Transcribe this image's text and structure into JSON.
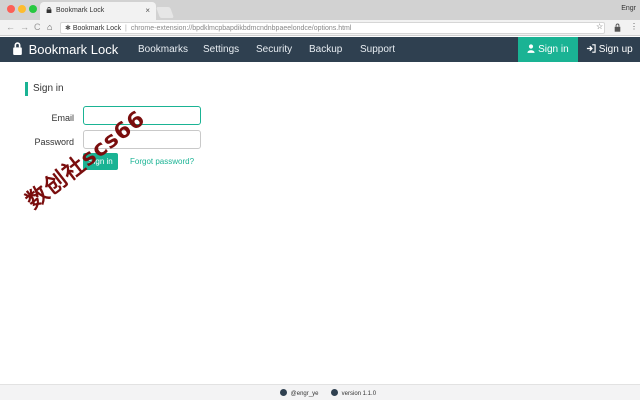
{
  "browser": {
    "tab_title": "Bookmark Lock",
    "tab_close": "×",
    "profile": "Engr",
    "omnibox_label": "Bookmark Lock",
    "omnibox_sep": "|",
    "url": "chrome-extension://bpdklmcpbapdikbdmcndnbpaeelondce/options.html"
  },
  "navbar": {
    "brand": "Bookmark Lock",
    "items": [
      "Bookmarks",
      "Settings",
      "Security",
      "Backup",
      "Support"
    ],
    "signin": "Sign in",
    "signup": "Sign up"
  },
  "form": {
    "title": "Sign in",
    "email_label": "Email",
    "email_value": "",
    "password_label": "Password",
    "password_value": "",
    "submit": "Sign in",
    "forgot": "Forgot password?"
  },
  "watermark": "数创社scs66",
  "footer": {
    "twitter": "@engr_ye",
    "version": "version 1.1.0"
  },
  "colors": {
    "accent": "#1ab394",
    "navbar": "#2f4050"
  },
  "icons": {
    "brand": "lock-icon",
    "signin": "user-icon",
    "signup": "sign-in-arrow-icon"
  }
}
